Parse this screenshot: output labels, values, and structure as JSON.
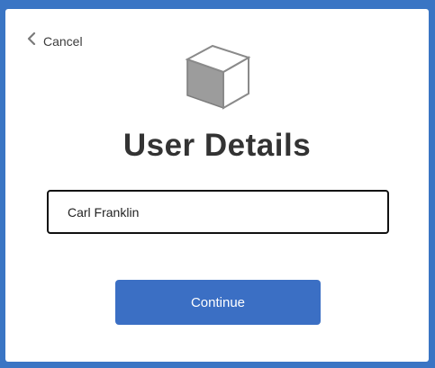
{
  "dialog": {
    "cancel_label": "Cancel",
    "cancel_icon": "chevron-left-icon",
    "logo_icon": "cube-icon",
    "title": "User Details",
    "name_input_value": "Carl Franklin",
    "continue_label": "Continue"
  },
  "colors": {
    "backdrop": "#3a75c4",
    "dialog_background": "#ffffff",
    "primary_button": "#3b6fc4",
    "title_text": "#333333"
  }
}
